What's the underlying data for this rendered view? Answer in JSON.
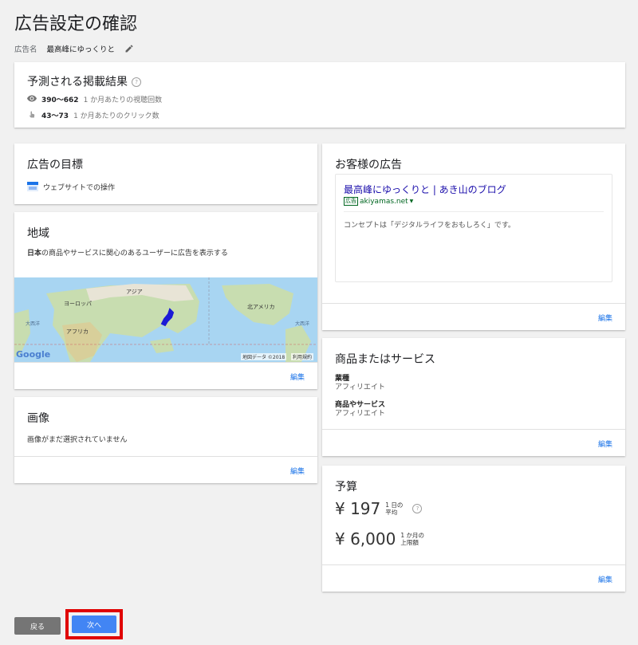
{
  "page": {
    "title": "広告設定の確認"
  },
  "ad_name": {
    "label": "広告名",
    "value": "最高峰にゆっくりと"
  },
  "forecast": {
    "title": "予測される掲載結果",
    "views_value": "390〜662",
    "views_label": "1 か月あたりの視聴回数",
    "clicks_value": "43〜73",
    "clicks_label": "1 か月あたりのクリック数"
  },
  "goal": {
    "title": "広告の目標",
    "value": "ウェブサイトでの操作"
  },
  "region": {
    "title": "地域",
    "desc_bold": "日本",
    "desc_rest": "の商品やサービスに関心のあるユーザーに広告を表示する",
    "map_labels": {
      "asia": "アジア",
      "europe": "ヨーロッパ",
      "africa": "アフリカ",
      "north_america": "北アメリカ",
      "atlantic_left": "大西洋",
      "atlantic_right": "大西洋",
      "google": "Google",
      "map_data": "地図データ ©2018",
      "terms": "利用規約"
    },
    "edit": "編集"
  },
  "image": {
    "title": "画像",
    "desc": "画像がまだ選択されていません",
    "edit": "編集"
  },
  "your_ad": {
    "title": "お客様の広告",
    "headline": "最高峰にゆっくりと | あき山のブログ",
    "badge": "広告",
    "url": "akiyamas.net",
    "description": "コンセプトは「デジタルライフをおもしろく」です。",
    "edit": "編集"
  },
  "product": {
    "title": "商品またはサービス",
    "category_label": "業種",
    "category_value": "アフィリエイト",
    "product_label": "商品やサービス",
    "product_value": "アフィリエイト",
    "edit": "編集"
  },
  "budget": {
    "title": "予算",
    "daily_amount": "¥ 197",
    "daily_label_1": "1 日の",
    "daily_label_2": "平均",
    "monthly_amount": "¥ 6,000",
    "monthly_label_1": "1 か月の",
    "monthly_label_2": "上限額",
    "edit": "編集"
  },
  "footer": {
    "back": "戻る",
    "next": "次へ"
  },
  "colors": {
    "accent": "#1a73e8",
    "next_button": "#4285f4",
    "back_button": "#757575",
    "highlight_box": "#e00000",
    "ad_link": "#1a0dab",
    "url_green": "#006621"
  }
}
